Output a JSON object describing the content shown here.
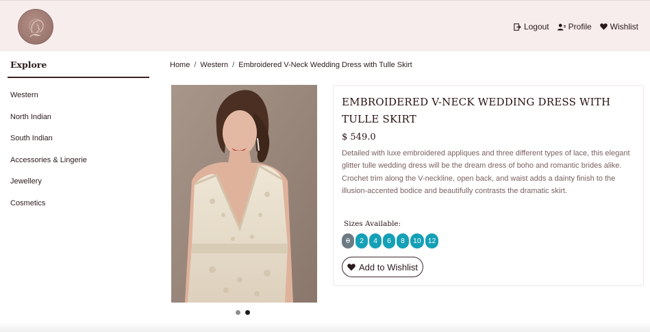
{
  "header": {
    "nav": {
      "logout_label": "Logout",
      "profile_label": "Profile",
      "wishlist_label": "Wishlist"
    }
  },
  "sidebar": {
    "title": "Explore",
    "items": [
      {
        "label": "Western"
      },
      {
        "label": "North Indian"
      },
      {
        "label": "South Indian"
      },
      {
        "label": "Accessories & Lingerie"
      },
      {
        "label": "Jewellery"
      },
      {
        "label": "Cosmetics"
      }
    ]
  },
  "breadcrumb": {
    "items": [
      "Home",
      "Western",
      "Embroidered V-Neck Wedding Dress with Tulle Skirt"
    ],
    "separator": "/"
  },
  "product": {
    "title": "EMBROIDERED V-NECK WEDDING DRESS WITH TULLE SKIRT",
    "price": "$ 549.0",
    "description": "Detailed with luxe embroidered appliques and three different types of lace, this elegant glitter tulle wedding dress will be the dream dress of boho and romantic brides alike. Crochet trim along the V-neckline, open back, and waist adds a dainty finish to the illusion-accented bodice and beautifully contrasts the dramatic skirt.",
    "sizes_label": "Sizes Available:",
    "sizes": [
      "0",
      "2",
      "4",
      "6",
      "8",
      "10",
      "12"
    ],
    "wishlist_button_label": "Add to Wishlist",
    "carousel": {
      "total": 2,
      "active": 2
    }
  },
  "colors": {
    "header_bg": "#f7eded",
    "size_pill": "#14a0b6",
    "size_pill_disabled": "#6c7a84",
    "text_dark": "#2a1a1a",
    "description_text": "#7a5f5f"
  },
  "icons": [
    "logo-portrait-icon",
    "logout-icon",
    "profile-icon",
    "heart-icon"
  ]
}
